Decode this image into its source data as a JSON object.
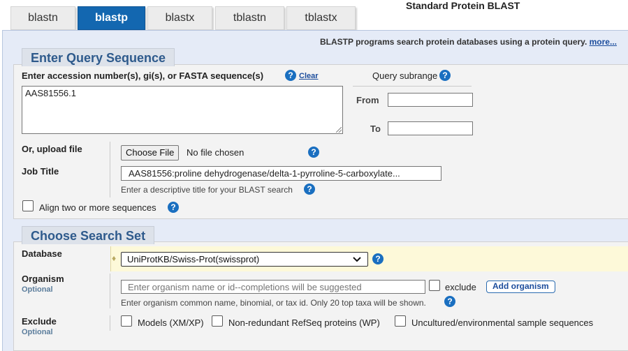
{
  "page_title": "Standard Protein BLAST",
  "tabs": [
    {
      "label": "blastn"
    },
    {
      "label": "blastp"
    },
    {
      "label": "blastx"
    },
    {
      "label": "tblastn"
    },
    {
      "label": "tblastx"
    }
  ],
  "active_tab": "blastp",
  "program_description": {
    "text": "BLASTP programs search protein databases using a protein query.",
    "more_link": "more..."
  },
  "query_section": {
    "legend": "Enter Query Sequence",
    "accession_label": "Enter accession number(s), gi(s), or FASTA sequence(s)",
    "clear_link": "Clear",
    "query_value": "AAS81556.1",
    "subrange_label": "Query subrange",
    "from_label": "From",
    "from_value": "",
    "to_label": "To",
    "to_value": "",
    "upload_label": "Or, upload file",
    "choose_file_button": "Choose File",
    "no_file_text": "No file chosen",
    "job_title_label": "Job Title",
    "job_title_value": "AAS81556:proline dehydrogenase/delta-1-pyrroline-5-carboxylate...",
    "job_title_hint": "Enter a descriptive title for your BLAST search",
    "align_label": "Align two or more sequences",
    "align_checked": false
  },
  "search_set_section": {
    "legend": "Choose Search Set",
    "database_label": "Database",
    "database_value": "UniProtKB/Swiss-Prot(swissprot)",
    "organism_label": "Organism",
    "organism_optional": "Optional",
    "organism_placeholder": "Enter organism name or id--completions will be suggested",
    "organism_exclude_label": "exclude",
    "add_organism_button": "Add organism",
    "organism_hint": "Enter organism common name, binomial, or tax id. Only 20 top taxa will be shown.",
    "exclude_label": "Exclude",
    "exclude_optional": "Optional",
    "exclude_options": [
      {
        "label": "Models (XM/XP)",
        "checked": false
      },
      {
        "label": "Non-redundant RefSeq proteins (WP)",
        "checked": false
      },
      {
        "label": "Uncultured/environmental sample sequences",
        "checked": false
      }
    ]
  },
  "icons": {
    "help": "question-circle-icon",
    "row_marker": "diamond-icon",
    "select_arrow": "chevron-down-icon"
  },
  "colors": {
    "active_tab": "#1367b0",
    "panel_background": "#e5ebf7",
    "section_background": "#f3f3f3",
    "legend_text": "#2e5a8c",
    "help_icon": "#1a6fc0",
    "link": "#1b4c9c",
    "database_row_highlight": "#fdf9d9"
  }
}
